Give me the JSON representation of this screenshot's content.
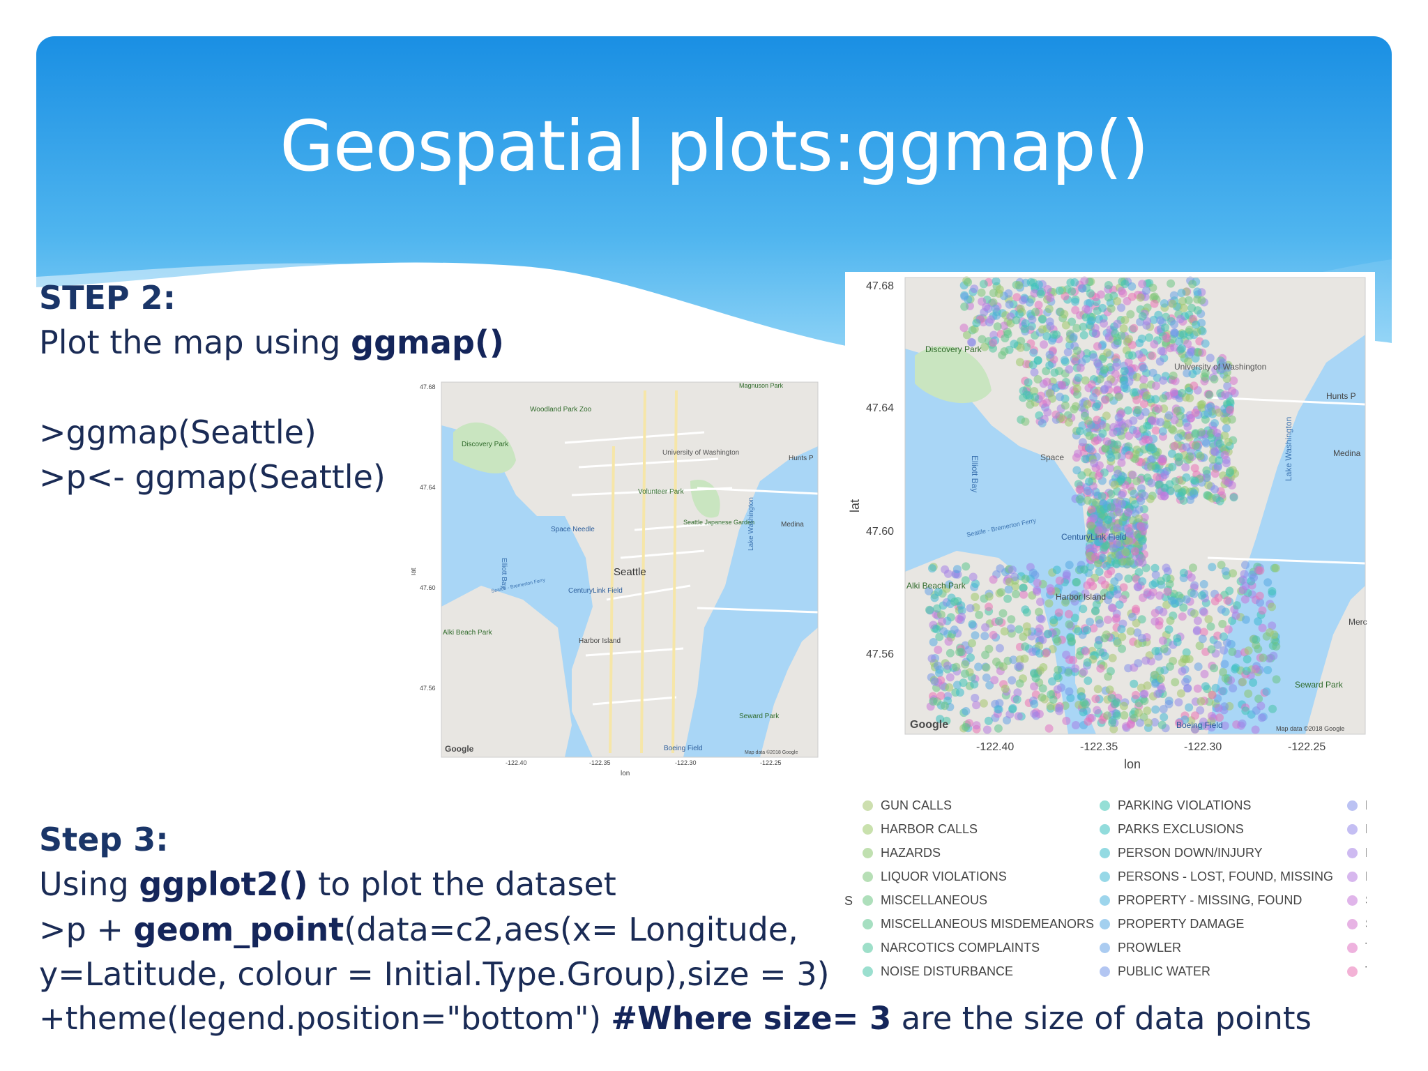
{
  "slide": {
    "title": "Geospatial plots:ggmap()",
    "colors": {
      "banner_top": "#1a8fe3",
      "banner_bottom": "#9fdcfa",
      "text": "#1a2b55"
    }
  },
  "step2": {
    "heading": "STEP 2:",
    "line1_prefix": "Plot the map using ",
    "line1_bold": "ggmap()",
    "code1": ">ggmap(Seattle)",
    "code2": ">p<- ggmap(Seattle)"
  },
  "step3": {
    "heading": "Step 3:",
    "line1_prefix": "Using ",
    "line1_bold": "ggplot2()",
    "line1_suffix": " to plot the dataset",
    "line2_prefix": ">p + ",
    "line2_bold": "geom_point",
    "line2_suffix": "(data=c2,aes(x= Longitude,",
    "line3": "y=Latitude, colour = Initial.Type.Group),size = 3)",
    "line4_prefix": "+theme(legend.position=\"bottom\") ",
    "line4_bold": "#Where size= 3",
    "line4_suffix": " are the size of data points"
  },
  "small_map": {
    "y_ticks": [
      "47.68",
      "47.64",
      "47.60",
      "47.56"
    ],
    "x_ticks": [
      "-122.40",
      "-122.35",
      "-122.30",
      "-122.25"
    ],
    "xlabel": "lon",
    "ylabel": "lat",
    "labels": {
      "discovery": "Discovery Park",
      "zoo": "Woodland Park Zoo",
      "uw": "University of Washington",
      "volunteer": "Volunteer Park",
      "space_needle": "Space Needle",
      "seattle": "Seattle",
      "japanese_garden": "Seattle Japanese Garden",
      "centurylink": "CenturyLink Field",
      "alki": "Alki Beach Park",
      "harbor": "Harbor Island",
      "seward": "Seward Park",
      "boeing": "Boeing Field",
      "medina": "Medina",
      "lake_washington": "Lake Washington",
      "elliott_bay": "Elliott Bay",
      "ferry": "Seattle - Bremerton Ferry",
      "hunts_point": "Hunts P",
      "magnuson": "Magnuson Park",
      "google": "Google",
      "map_data": "Map data ©2018 Google"
    }
  },
  "large_map": {
    "y_ticks": [
      "47.68",
      "47.64",
      "47.60",
      "47.56"
    ],
    "x_ticks": [
      "-122.40",
      "-122.35",
      "-122.30",
      "-122.25"
    ],
    "xlabel": "lon",
    "ylabel": "lat",
    "labels": {
      "discovery": "Discovery Park",
      "uw": "University of Washington",
      "space": "Space",
      "centurylink": "CenturyLink Field",
      "alki": "Alki Beach Park",
      "harbor": "Harbor Island",
      "seward": "Seward Park",
      "boeing": "Boeing Field",
      "medina": "Medina",
      "lake_washington": "Lake Washington",
      "elliott_bay": "Elliott Bay",
      "ferry": "Seattle - Bremerton Ferry",
      "hunts_point": "Hunts P",
      "mercer": "Merc",
      "google": "Google",
      "map_data": "Map data ©2018 Google"
    }
  },
  "legend": {
    "col1": [
      {
        "label": "GUN CALLS",
        "color": "#a4c46e"
      },
      {
        "label": "HARBOR CALLS",
        "color": "#9cc86a"
      },
      {
        "label": "HAZARDS",
        "color": "#8cc770"
      },
      {
        "label": "LIQUOR VIOLATIONS",
        "color": "#7cc47a"
      },
      {
        "label": "MISCELLANEOUS",
        "color": "#6cc484"
      },
      {
        "label": "MISCELLANEOUS MISDEMEANORS",
        "color": "#5cc48e"
      },
      {
        "label": "NARCOTICS COMPLAINTS",
        "color": "#4ec49c"
      },
      {
        "label": "NOISE DISTURBANCE",
        "color": "#48c4a8"
      }
    ],
    "col2": [
      {
        "label": "PARKING VIOLATIONS",
        "color": "#3ec4b4"
      },
      {
        "label": "PARKS EXCLUSIONS",
        "color": "#38c0c0"
      },
      {
        "label": "PERSON DOWN/INJURY",
        "color": "#3abcca"
      },
      {
        "label": "PERSONS - LOST, FOUND, MISSING",
        "color": "#42b8d4"
      },
      {
        "label": "PROPERTY - MISSING, FOUND",
        "color": "#4cb2dc"
      },
      {
        "label": "PROPERTY DAMAGE",
        "color": "#58aae2"
      },
      {
        "label": "PROWLER",
        "color": "#66a2e6"
      },
      {
        "label": "PUBLIC WATER",
        "color": "#7498e8"
      }
    ],
    "col3": [
      {
        "label": "RI",
        "color": "#8490ea"
      },
      {
        "label": "RI",
        "color": "#9488ea"
      },
      {
        "label": "R(",
        "color": "#a682e6"
      },
      {
        "label": "R(",
        "color": "#b67ce0"
      },
      {
        "label": "SE",
        "color": "#c678d8"
      },
      {
        "label": "SU",
        "color": "#d474ce"
      },
      {
        "label": "TH",
        "color": "#e072c2"
      },
      {
        "label": "TH",
        "color": "#ea72b4"
      }
    ],
    "left_fragment": "S"
  }
}
